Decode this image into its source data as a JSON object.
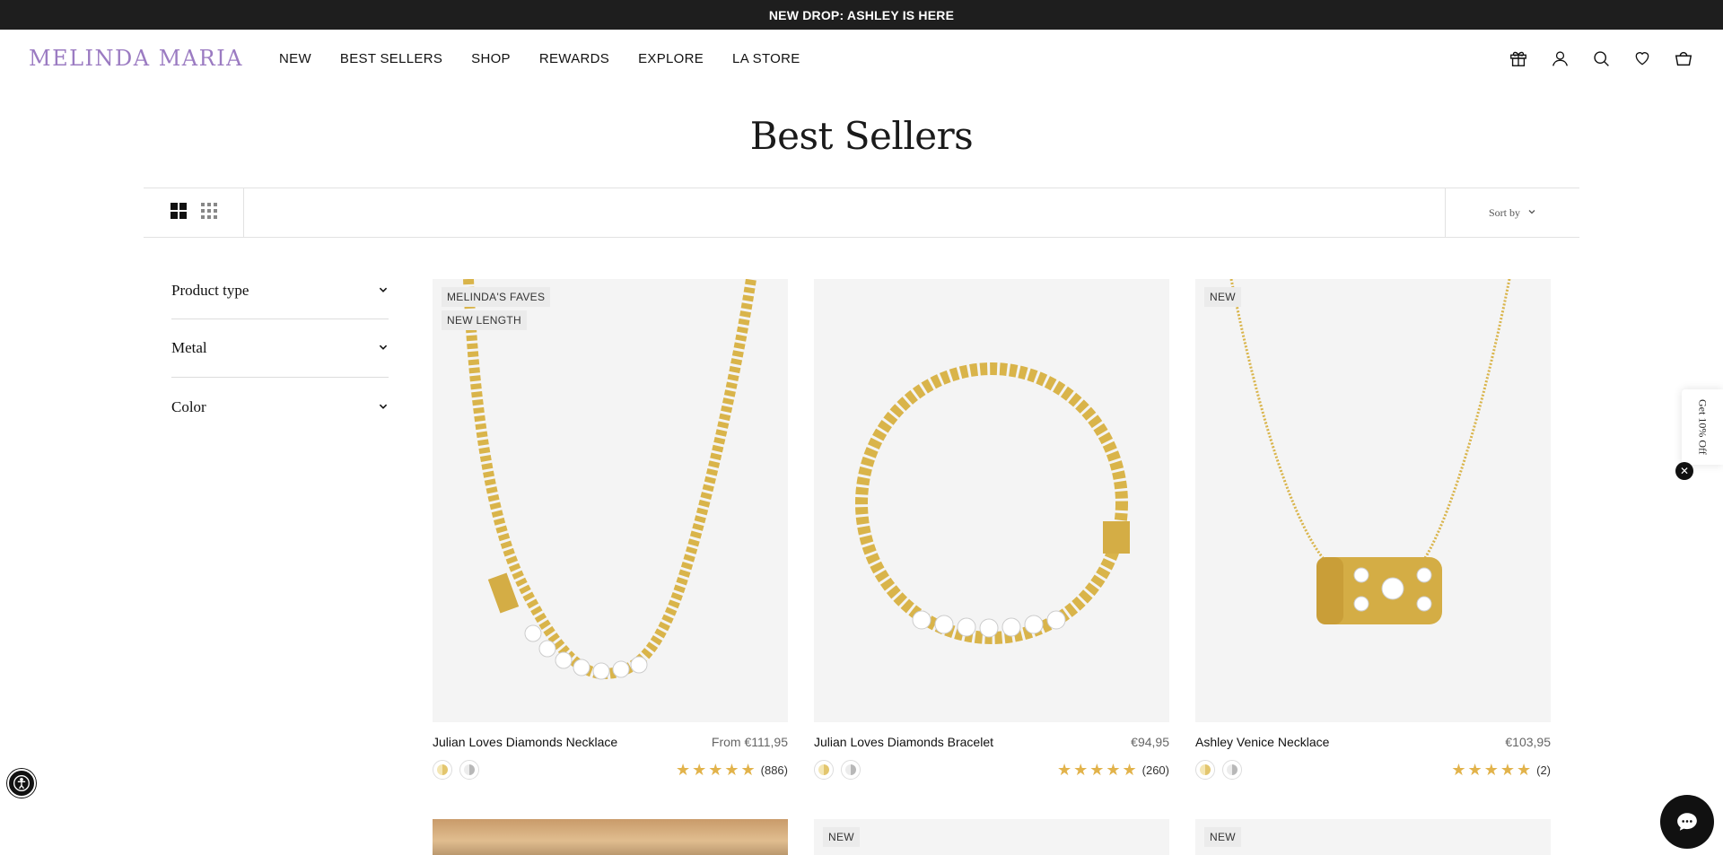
{
  "announcement": "NEW DROP: ASHLEY IS HERE",
  "logo": "MELINDA MARIA",
  "nav": [
    "NEW",
    "BEST SELLERS",
    "SHOP",
    "REWARDS",
    "EXPLORE",
    "LA STORE"
  ],
  "header_icons": [
    "gift-icon",
    "account-icon",
    "search-icon",
    "wishlist-icon",
    "cart-icon"
  ],
  "page_title": "Best Sellers",
  "toolbar": {
    "sort_label": "Sort by"
  },
  "filters": [
    "Product type",
    "Metal",
    "Color"
  ],
  "products": [
    {
      "badges": [
        "MELINDA'S FAVES",
        "NEW LENGTH"
      ],
      "title": "Julian Loves Diamonds Necklace",
      "price": "From €111,95",
      "rating": 5,
      "reviews": "(886)",
      "swatches": [
        "gold",
        "silver"
      ]
    },
    {
      "badges": [],
      "title": "Julian Loves Diamonds Bracelet",
      "price": "€94,95",
      "rating": 5,
      "reviews": "(260)",
      "swatches": [
        "gold",
        "silver"
      ]
    },
    {
      "badges": [
        "NEW"
      ],
      "title": "Ashley Venice Necklace",
      "price": "€103,95",
      "rating": 5,
      "reviews": "(2)",
      "swatches": [
        "gold",
        "silver"
      ]
    }
  ],
  "row2_badges": [
    "",
    "NEW",
    "NEW"
  ],
  "side_tab": "Get 10% Off",
  "colors": {
    "brand": "#9b7bc2",
    "announce_bg": "#1e1e1e",
    "star": "#e2b34b"
  }
}
